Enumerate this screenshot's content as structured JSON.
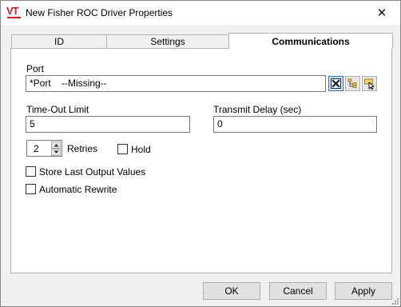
{
  "window": {
    "title": "New Fisher ROC Driver Properties",
    "close_glyph": "✕",
    "logo_text": "VT"
  },
  "tabs": [
    {
      "label": "ID",
      "active": false
    },
    {
      "label": "Settings",
      "active": false
    },
    {
      "label": "Communications",
      "active": true
    }
  ],
  "communications": {
    "port": {
      "label": "Port",
      "value": "*Port    --Missing--",
      "buttons": [
        {
          "icon": "clear-x-icon",
          "pressed": true
        },
        {
          "icon": "tag-browser-icon",
          "pressed": false
        },
        {
          "icon": "tag-edit-icon",
          "pressed": false
        }
      ]
    },
    "timeout": {
      "label": "Time-Out Limit",
      "value": "5"
    },
    "transmit_delay": {
      "label": "Transmit Delay (sec)",
      "value": "0"
    },
    "retries": {
      "label": "Retries",
      "value": "2"
    },
    "hold": {
      "label": "Hold",
      "checked": false
    },
    "store_last_output": {
      "label": "Store Last Output Values",
      "checked": false
    },
    "automatic_rewrite": {
      "label": "Automatic Rewrite",
      "checked": false
    }
  },
  "buttons": {
    "ok": "OK",
    "cancel": "Cancel",
    "apply": "Apply"
  },
  "colors": {
    "logo_red": "#cc1f1f",
    "dialog_bg": "#f0f0f0",
    "panel_bg": "#ffffff",
    "focus_blue": "#2a6fb8"
  }
}
